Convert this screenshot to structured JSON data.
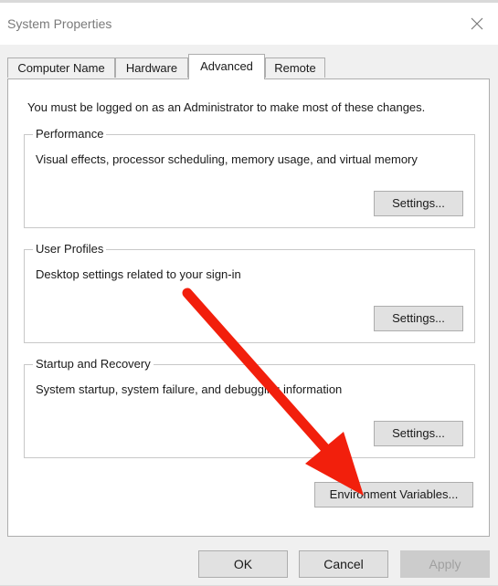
{
  "window": {
    "title": "System Properties",
    "close_glyph": "✕"
  },
  "tabs": [
    {
      "label": "Computer Name",
      "active": false
    },
    {
      "label": "Hardware",
      "active": false
    },
    {
      "label": "Advanced",
      "active": true
    },
    {
      "label": "Remote",
      "active": false
    }
  ],
  "advanced": {
    "admin_note": "You must be logged on as an Administrator to make most of these changes.",
    "performance": {
      "title": "Performance",
      "description": "Visual effects, processor scheduling, memory usage, and virtual memory",
      "button": "Settings..."
    },
    "user_profiles": {
      "title": "User Profiles",
      "description": "Desktop settings related to your sign-in",
      "button": "Settings..."
    },
    "startup_recovery": {
      "title": "Startup and Recovery",
      "description": "System startup, system failure, and debugging information",
      "button": "Settings..."
    },
    "env_button": "Environment Variables..."
  },
  "footer": {
    "ok": "OK",
    "cancel": "Cancel",
    "apply": "Apply"
  },
  "icons": {
    "close": "close-icon",
    "annotation": "red-arrow-icon"
  },
  "colors": {
    "annotation_arrow": "#f21f0c",
    "disabled_text": "#a0a0a0"
  }
}
